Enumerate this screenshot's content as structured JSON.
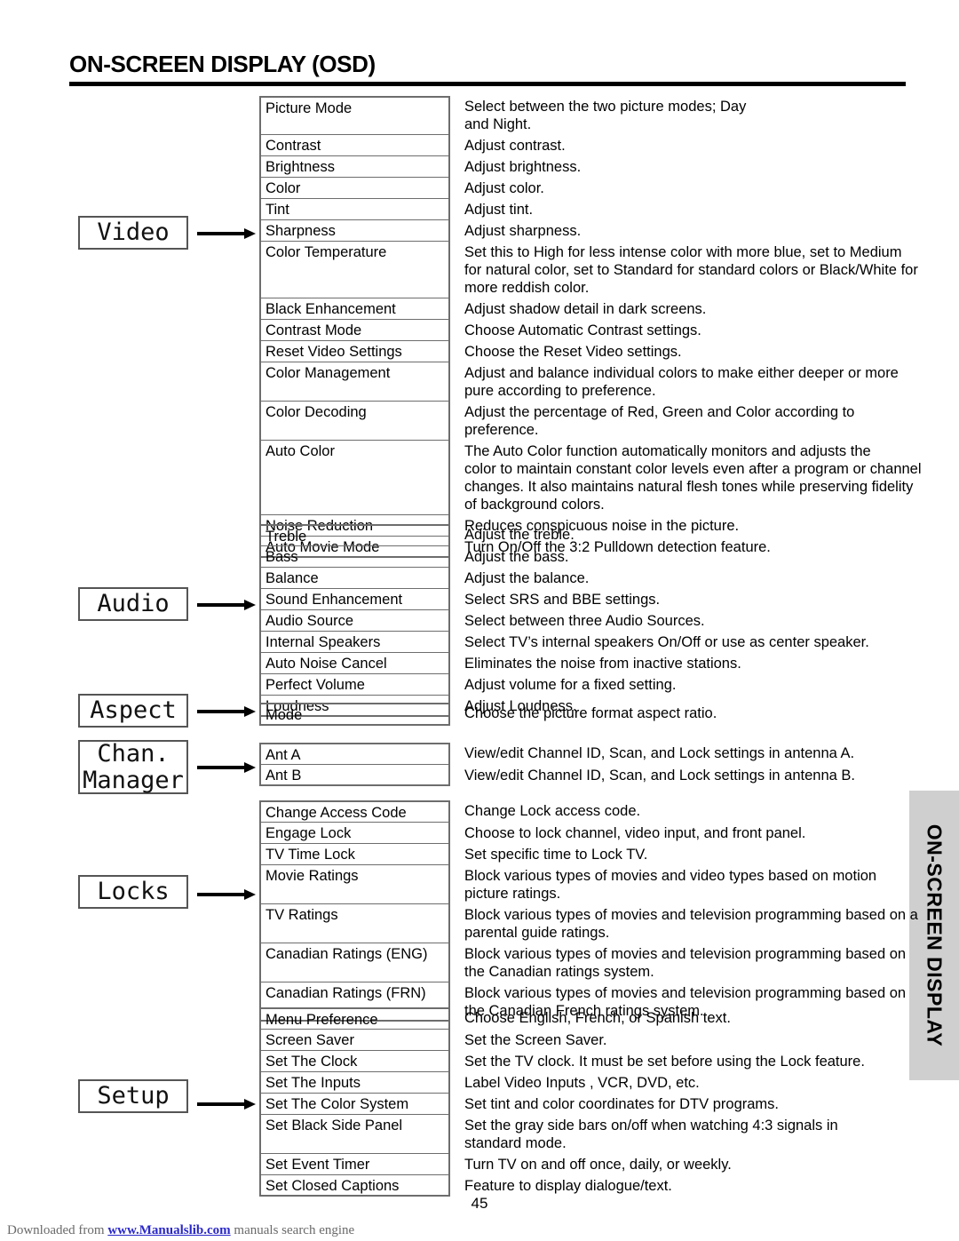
{
  "page": {
    "title": "ON-SCREEN DISPLAY (OSD)",
    "number": "45",
    "side_tab_label": "ON-SCREEN DISPLAY"
  },
  "footer": {
    "prefix": "Downloaded from ",
    "link": "www.Manualslib.com",
    "suffix": " manuals search engine"
  },
  "colors": {
    "rule": "#000000",
    "side_tab_bg": "#cfcfcf",
    "table_border": "#6d6d6d",
    "link": "#2a28c8"
  },
  "categories": [
    {
      "key": "video",
      "label": "Video",
      "label_lines": [
        "Video"
      ]
    },
    {
      "key": "audio",
      "label": "Audio",
      "label_lines": [
        "Audio"
      ]
    },
    {
      "key": "aspect",
      "label": "Aspect",
      "label_lines": [
        "Aspect"
      ]
    },
    {
      "key": "chan",
      "label": "Chan. Manager",
      "label_lines": [
        "Chan.",
        "Manager"
      ]
    },
    {
      "key": "locks",
      "label": "Locks",
      "label_lines": [
        "Locks"
      ]
    },
    {
      "key": "setup",
      "label": "Setup",
      "label_lines": [
        "Setup"
      ]
    }
  ],
  "sections": {
    "video": {
      "rows": [
        {
          "label": "Picture Mode",
          "desc": [
            "Select between the two picture modes; Day",
            "and Night."
          ]
        },
        {
          "label": "Contrast",
          "desc": [
            "Adjust contrast."
          ]
        },
        {
          "label": "Brightness",
          "desc": [
            "Adjust brightness."
          ]
        },
        {
          "label": "Color",
          "desc": [
            "Adjust color."
          ]
        },
        {
          "label": "Tint",
          "desc": [
            "Adjust tint."
          ]
        },
        {
          "label": "Sharpness",
          "desc": [
            "Adjust sharpness."
          ]
        },
        {
          "label": "Color Temperature",
          "desc": [
            "Set this to High for less intense color with more blue, set to Medium",
            "for natural color, set to Standard for standard colors or Black/White for",
            "more reddish color."
          ]
        },
        {
          "label": "Black Enhancement",
          "desc": [
            "Adjust shadow detail in dark screens."
          ]
        },
        {
          "label": "Contrast Mode",
          "desc": [
            "Choose Automatic Contrast settings."
          ]
        },
        {
          "label": "Reset Video Settings",
          "desc": [
            "Choose the Reset Video settings."
          ]
        },
        {
          "label": "Color Management",
          "desc": [
            "Adjust and balance individual colors to make either deeper or more",
            "pure according to preference."
          ]
        },
        {
          "label": "Color Decoding",
          "desc": [
            "Adjust the percentage of Red, Green and Color according to",
            "preference."
          ]
        },
        {
          "label": "Auto Color",
          "desc": [
            "The Auto Color function automatically monitors and adjusts the",
            "color to maintain constant color levels even after a program or channel",
            "changes. It also maintains natural flesh tones while preserving fidelity",
            "of background colors."
          ]
        },
        {
          "label": "Noise Reduction",
          "desc": [
            "Reduces conspicuous noise in the picture."
          ]
        },
        {
          "label": "Auto Movie Mode",
          "desc": [
            "Turn On/Off the 3:2 Pulldown detection feature."
          ]
        }
      ]
    },
    "audio": {
      "rows": [
        {
          "label": "Treble",
          "desc": [
            "Adjust the treble."
          ]
        },
        {
          "label": "Bass",
          "desc": [
            "Adjust the bass."
          ]
        },
        {
          "label": "Balance",
          "desc": [
            "Adjust the balance."
          ]
        },
        {
          "label": "Sound Enhancement",
          "desc": [
            "Select SRS and BBE settings."
          ]
        },
        {
          "label": "Audio Source",
          "desc": [
            "Select between three Audio Sources."
          ]
        },
        {
          "label": "Internal Speakers",
          "desc": [
            "Select TV’s internal speakers On/Off or use as center speaker."
          ]
        },
        {
          "label": "Auto Noise Cancel",
          "desc": [
            "Eliminates the noise from inactive stations."
          ]
        },
        {
          "label": "Perfect Volume",
          "desc": [
            "Adjust volume for a fixed setting."
          ]
        },
        {
          "label": "Loudness",
          "desc": [
            "Adjust Loudness."
          ]
        }
      ]
    },
    "aspect": {
      "rows": [
        {
          "label": "Mode",
          "desc": [
            "Choose the picture format aspect ratio."
          ]
        }
      ]
    },
    "chan": {
      "rows": [
        {
          "label": "Ant A",
          "desc": [
            "View/edit Channel ID, Scan, and Lock settings in antenna A."
          ]
        },
        {
          "label": "Ant B",
          "desc": [
            "View/edit Channel ID, Scan, and Lock settings in antenna B."
          ]
        }
      ]
    },
    "locks": {
      "rows": [
        {
          "label": "Change Access Code",
          "desc": [
            "Change Lock access code."
          ]
        },
        {
          "label": "Engage Lock",
          "desc": [
            "Choose to lock channel, video input, and front panel."
          ]
        },
        {
          "label": "TV Time Lock",
          "desc": [
            "Set specific time to Lock TV."
          ]
        },
        {
          "label": "Movie Ratings",
          "desc": [
            "Block various types of movies and video types based on motion",
            "picture ratings."
          ]
        },
        {
          "label": "TV Ratings",
          "desc": [
            "Block various types of movies and television programming based on a",
            "parental guide ratings."
          ]
        },
        {
          "label": "Canadian Ratings (ENG)",
          "desc": [
            "Block various types of movies and television programming based on",
            "the Canadian ratings system."
          ]
        },
        {
          "label": "Canadian Ratings (FRN)",
          "desc": [
            "Block various types of movies and television programming based on",
            "the Canadian French ratings system."
          ]
        }
      ]
    },
    "setup": {
      "rows": [
        {
          "label": "Menu Preference",
          "desc": [
            "Choose English, French, or Spanish text."
          ]
        },
        {
          "label": "Screen Saver",
          "desc": [
            "Set the Screen Saver."
          ]
        },
        {
          "label": "Set The Clock",
          "desc": [
            "Set the TV clock.  It must be set before using the Lock feature."
          ]
        },
        {
          "label": "Set The Inputs",
          "desc": [
            "Label Video Inputs , VCR, DVD, etc."
          ]
        },
        {
          "label": "Set The Color System",
          "desc": [
            "Set tint and color coordinates for DTV programs."
          ]
        },
        {
          "label": "Set Black Side Panel",
          "desc": [
            "Set the gray side bars on/off when watching 4:3 signals in",
            "standard mode."
          ]
        },
        {
          "label": "Set Event Timer",
          "desc": [
            "Turn TV on and off once, daily, or weekly."
          ]
        },
        {
          "label": "Set Closed Captions",
          "desc": [
            "Feature to display dialogue/text."
          ]
        }
      ]
    }
  }
}
